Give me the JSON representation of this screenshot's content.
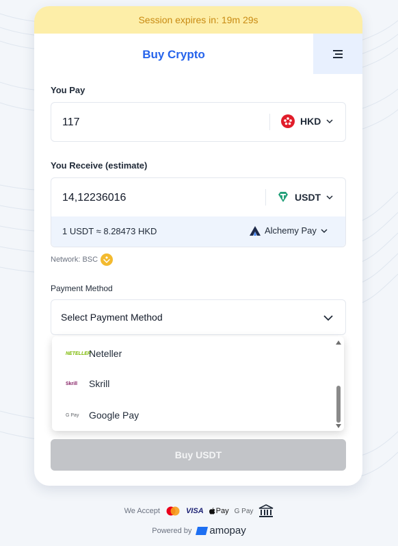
{
  "session": {
    "text": "Session expires in: 19m 29s"
  },
  "header": {
    "title": "Buy Crypto",
    "menu_icon": "hamburger-icon"
  },
  "pay": {
    "label": "You Pay",
    "amount": "117",
    "currency": "HKD",
    "currency_icon": "hk-flag-icon"
  },
  "receive": {
    "label": "You Receive (estimate)",
    "amount": "14,12236016",
    "currency": "USDT",
    "currency_icon": "tether-icon",
    "rate": "1 USDT ≈ 8.28473 HKD",
    "provider": "Alchemy Pay",
    "provider_icon": "alchemy-pay-icon"
  },
  "network": {
    "label": "Network: BSC",
    "icon": "bnb-icon"
  },
  "payment": {
    "label": "Payment Method",
    "placeholder": "Select Payment Method",
    "options": [
      {
        "label": "Neteller",
        "logo": "NETELLER",
        "logo_color": "#7ab800"
      },
      {
        "label": "Skrill",
        "logo": "Skrill",
        "logo_color": "#862165"
      },
      {
        "label": "Google Pay",
        "logo": "G Pay",
        "logo_color": "#5f6368"
      }
    ]
  },
  "buy_button": {
    "label": "Buy USDT"
  },
  "footer": {
    "we_accept": "We Accept",
    "visa": "VISA",
    "applepay": "Pay",
    "gpay": "G Pay",
    "powered_by": "Powered by",
    "brand": "amopay"
  },
  "colors": {
    "accent": "#2563eb",
    "session_bg": "#fdeea8",
    "session_text": "#c88a12",
    "button_disabled": "#c2c4c8"
  }
}
